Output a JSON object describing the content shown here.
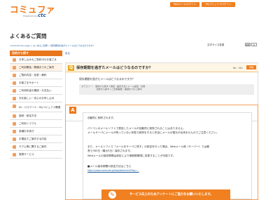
{
  "header": {
    "logo": "コミュファ",
    "logo_sub": "Powered by",
    "logo_ctc": "ctc",
    "web_login": "Webメールログイン",
    "my_login": "Myコミュファログイン"
  },
  "page_title": "よくあるご質問",
  "breadcrumb": "commufa top page > よくあるご質問 > 保存期間を過ぎたメールはどうなるのですか？",
  "font_size_label": "文字サイズ変更",
  "font_size_std": "標準",
  "font_size_large": "大",
  "sidebar": {
    "heading": "目的から探す",
    "items": [
      {
        "label": "お申し込み＆ご契約中のお客さま"
      },
      {
        "label": "ご利用開始・開通までのご案内"
      },
      {
        "label": "ご契約内容・変更・解約"
      },
      {
        "label": "お客さまサポート"
      },
      {
        "label": "ご利用料金の確認・お支払い"
      },
      {
        "label": "光を楽しい・安心のお申し込み"
      },
      {
        "label": "ID・パスワード・Myコミュファ関連"
      },
      {
        "label": "接続・設定方法"
      },
      {
        "label": "ご利用トラブル"
      },
      {
        "label": "各種お手続き"
      },
      {
        "label": "お電話でご案内する内容"
      },
      {
        "label": "モデム等に関するご案内"
      },
      {
        "label": "提携サービス"
      }
    ]
  },
  "main": {
    "back": "戻る",
    "q_icon": "Q",
    "q_title": "保存期間を過ぎたメールはどうなるのですか？",
    "q_no": "No：344",
    "print": "印刷",
    "q_text": "保存期間を過ぎたメールはどうなるのですか？",
    "categories": [
      "カテゴリー：　契約から探す＞接続・設定方法＞メール設定・仕様",
      "　　　　　　　目的から探す＞ご利用開始・開通までのご案内"
    ],
    "a_icon": "A",
    "answer": [
      "自動的に削除されます。",
      "パソコンのメールソフトで受信したメールが自動的に削除されることはありません。",
      "メールサーバにメールが残っていない状態で削除をすると完全にメールの復元が出来ませんのでご注意ください。",
      "また、メールソフトで「メールをサーバに残す」の設定を行った場合、Webメール側（サーバー）では最",
      "長で365日（最大5日）保存されます。",
      "Webメールの保存期間は設定により無期限期限に変更することが可能です。",
      "■メール保存期間の設定方法はこちら"
    ],
    "link": "https://www.commufa.jp/faq/detail.html?faq=...",
    "survey": "サービス向上のためアンケートにご協力をお願いいたします。"
  }
}
